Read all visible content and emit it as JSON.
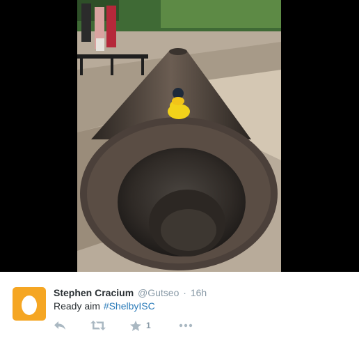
{
  "tweet": {
    "display_name": "Stephen Cracium",
    "handle": "@Gutseo",
    "separator": "·",
    "timestamp": "16h",
    "text": "Ready aim",
    "hashtag": "#ShelbyISC"
  },
  "actions": {
    "reply_icon": "reply-icon",
    "retweet_icon": "retweet-icon",
    "favorite_icon": "star-icon",
    "favorite_count": "1",
    "more_icon": "more-dots-icon"
  },
  "colors": {
    "avatar_bg": "#f5a623",
    "link": "#2b7bb9",
    "muted": "#8899a6",
    "name": "#292f33",
    "icon": "#aab8c2"
  }
}
